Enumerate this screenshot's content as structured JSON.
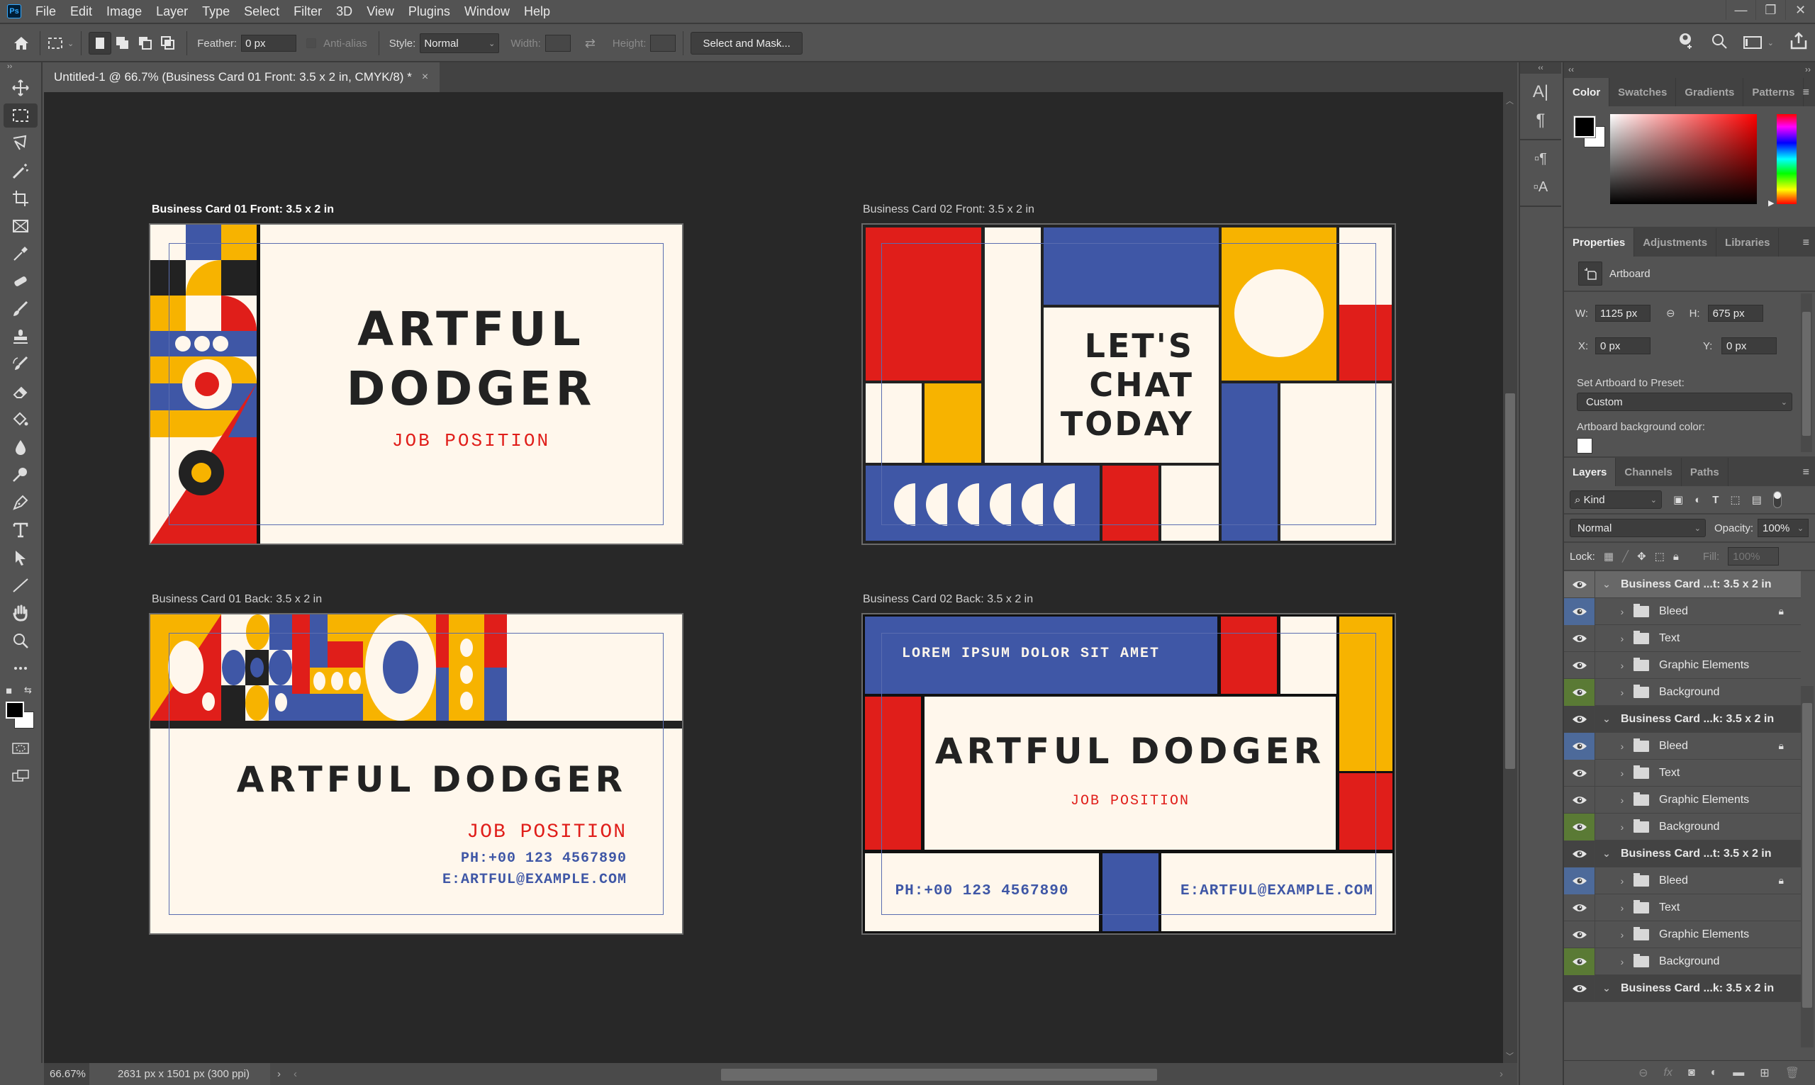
{
  "app": {
    "logo": "Ps"
  },
  "menu": [
    "File",
    "Edit",
    "Image",
    "Layer",
    "Type",
    "Select",
    "Filter",
    "3D",
    "View",
    "Plugins",
    "Window",
    "Help"
  ],
  "window_controls": {
    "minimize": "—",
    "restore": "❐",
    "close": "✕"
  },
  "options_bar": {
    "feather_label": "Feather:",
    "feather_value": "0 px",
    "antialias_label": "Anti-alias",
    "style_label": "Style:",
    "style_value": "Normal",
    "width_label": "Width:",
    "height_label": "Height:",
    "select_mask": "Select and Mask..."
  },
  "document_tab": {
    "title": "Untitled-1 @ 66.7% (Business Card 01 Front: 3.5 x 2 in, CMYK/8) *",
    "close": "×"
  },
  "artboards": {
    "card01_front": {
      "label": "Business Card 01 Front: 3.5 x 2 in",
      "name_line1": "ARTFUL",
      "name_line2": "DODGER",
      "position": "JOB POSITION"
    },
    "card02_front": {
      "label": "Business Card 02 Front: 3.5 x 2 in",
      "line1": "LET'S",
      "line2": "CHAT",
      "line3": "TODAY"
    },
    "card01_back": {
      "label": "Business Card 01 Back: 3.5 x 2 in",
      "name": "ARTFUL DODGER",
      "position": "JOB POSITION",
      "phone": "PH:+00 123 4567890",
      "email": "E:ARTFUL@EXAMPLE.COM"
    },
    "card02_back": {
      "label": "Business Card 02 Back: 3.5 x 2 in",
      "tagline": "LOREM IPSUM DOLOR SIT AMET",
      "name": "ARTFUL DODGER",
      "position": "JOB POSITION",
      "phone": "PH:+00 123 4567890",
      "email": "E:ARTFUL@EXAMPLE.COM"
    }
  },
  "colors": {
    "red": "#e01e1a",
    "yellow": "#f7b300",
    "blue": "#3f57a6",
    "cream": "#fff7ec",
    "ink": "#222222"
  },
  "color_panel": {
    "tabs": [
      "Color",
      "Swatches",
      "Gradients",
      "Patterns"
    ],
    "active": "Color",
    "foreground": "#000000",
    "background": "#ffffff"
  },
  "properties_panel": {
    "tabs": [
      "Properties",
      "Adjustments",
      "Libraries"
    ],
    "type": "Artboard",
    "w_label": "W:",
    "w_value": "1125 px",
    "h_label": "H:",
    "h_value": "675 px",
    "x_label": "X:",
    "x_value": "0 px",
    "y_label": "Y:",
    "y_value": "0 px",
    "preset_label": "Set Artboard to Preset:",
    "preset_value": "Custom",
    "bg_color_label": "Artboard background color:"
  },
  "layers_panel": {
    "tabs": [
      "Layers",
      "Channels",
      "Paths"
    ],
    "filter_kind": "Kind",
    "blend_mode": "Normal",
    "opacity_label": "Opacity:",
    "opacity_value": "100%",
    "lock_label": "Lock:",
    "fill_label": "Fill:",
    "fill_value": "100%",
    "layers": [
      {
        "name": "Business Card ...t: 3.5 x 2 in",
        "type": "artboard",
        "selected": true
      },
      {
        "name": "Bleed",
        "type": "folder",
        "eye": "blue",
        "locked": true
      },
      {
        "name": "Text",
        "type": "folder"
      },
      {
        "name": "Graphic Elements",
        "type": "folder"
      },
      {
        "name": "Background",
        "type": "folder",
        "eye": "green"
      },
      {
        "name": "Business Card ...k: 3.5 x 2 in",
        "type": "artboard"
      },
      {
        "name": "Bleed",
        "type": "folder",
        "eye": "blue",
        "locked": true
      },
      {
        "name": "Text",
        "type": "folder"
      },
      {
        "name": "Graphic Elements",
        "type": "folder"
      },
      {
        "name": "Background",
        "type": "folder",
        "eye": "green"
      },
      {
        "name": "Business Card ...t: 3.5 x 2 in",
        "type": "artboard"
      },
      {
        "name": "Bleed",
        "type": "folder",
        "eye": "blue",
        "locked": true
      },
      {
        "name": "Text",
        "type": "folder"
      },
      {
        "name": "Graphic Elements",
        "type": "folder"
      },
      {
        "name": "Background",
        "type": "folder",
        "eye": "green"
      },
      {
        "name": "Business Card ...k: 3.5 x 2 in",
        "type": "artboard"
      }
    ]
  },
  "status_bar": {
    "zoom": "66.67%",
    "doc_info": "2631 px x 1501 px (300 ppi)"
  }
}
